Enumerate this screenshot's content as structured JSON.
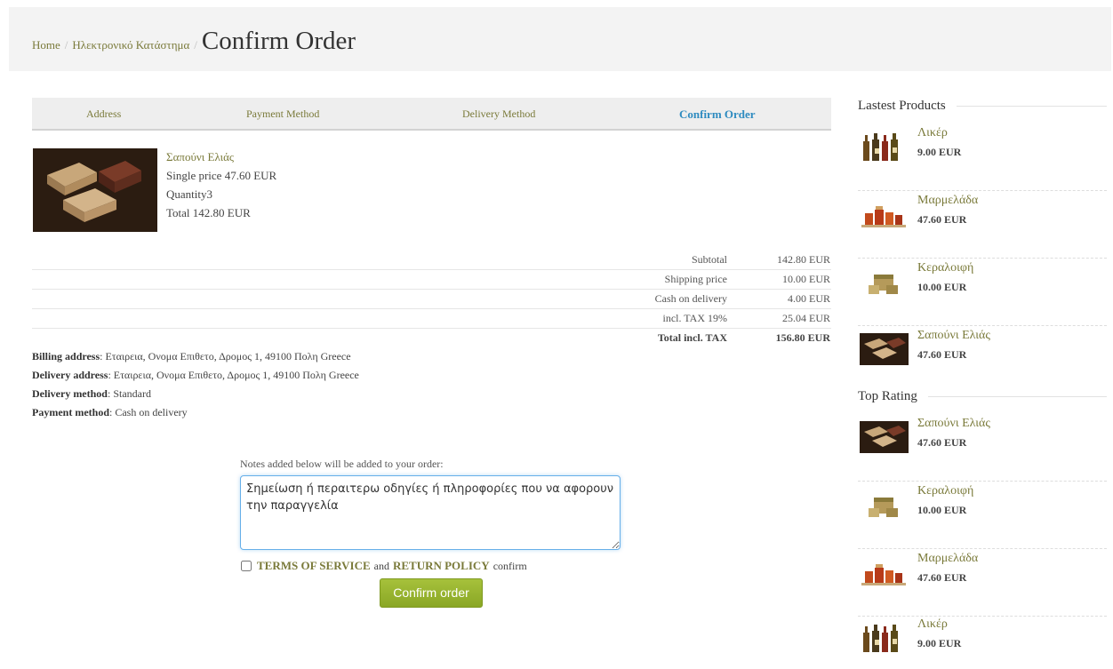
{
  "breadcrumb": {
    "home": "Home",
    "sep": "/",
    "shop": "Ηλεκτρονικό Κατάστημα",
    "title": "Confirm Order"
  },
  "steps": {
    "address": "Address",
    "payment": "Payment Method",
    "delivery": "Delivery Method",
    "confirm": "Confirm Order"
  },
  "product": {
    "name": "Σαπούνι Ελιάς",
    "single_price": "Single price 47.60 EUR",
    "quantity": "Quantity3",
    "total": "Total 142.80 EUR"
  },
  "totals": [
    {
      "label": "Subtotal",
      "value": "142.80 EUR"
    },
    {
      "label": "Shipping price",
      "value": "10.00 EUR"
    },
    {
      "label": "Cash on delivery",
      "value": "4.00 EUR"
    },
    {
      "label": "incl. TAX 19%",
      "value": "25.04 EUR"
    },
    {
      "label": "Total incl. TAX",
      "value": "156.80 EUR"
    }
  ],
  "addresses": {
    "billing_label": "Billing address",
    "billing_value": ": Εταιρεια, Ονομα Επιθετο, Δρομος 1, 49100 Πολη Greece",
    "delivery_label": "Delivery address",
    "delivery_value": ": Εταιρεια, Ονομα Επιθετο, Δρομος 1, 49100 Πολη Greece",
    "method_label": "Delivery method",
    "method_value": ": Standard",
    "payment_label": "Payment method",
    "payment_value": ": Cash on delivery"
  },
  "notes": {
    "label": "Notes added below will be added to your order:",
    "value": "Σημείωση ή περαιτερω οδηγίες ή πληροφορίες που να αφορουν την παραγγελία"
  },
  "terms": {
    "tos": "TERMS OF SERVICE",
    "and": "and",
    "return": "RETURN POLICY",
    "confirm": "confirm"
  },
  "confirm_button": "Confirm order",
  "sidebar": {
    "latest_title": "Lastest Products",
    "latest": [
      {
        "name": "Λικέρ",
        "price": "9.00 EUR",
        "icon": "bottles"
      },
      {
        "name": "Μαρμελάδα",
        "price": "47.60 EUR",
        "icon": "jars"
      },
      {
        "name": "Κεραλοιφή",
        "price": "10.00 EUR",
        "icon": "balm"
      },
      {
        "name": "Σαπούνι Ελιάς",
        "price": "47.60 EUR",
        "icon": "soap"
      }
    ],
    "top_title": "Top Rating",
    "top": [
      {
        "name": "Σαπούνι Ελιάς",
        "price": "47.60 EUR",
        "icon": "soap"
      },
      {
        "name": "Κεραλοιφή",
        "price": "10.00 EUR",
        "icon": "balm"
      },
      {
        "name": "Μαρμελάδα",
        "price": "47.60 EUR",
        "icon": "jars"
      },
      {
        "name": "Λικέρ",
        "price": "9.00 EUR",
        "icon": "bottles"
      }
    ]
  }
}
